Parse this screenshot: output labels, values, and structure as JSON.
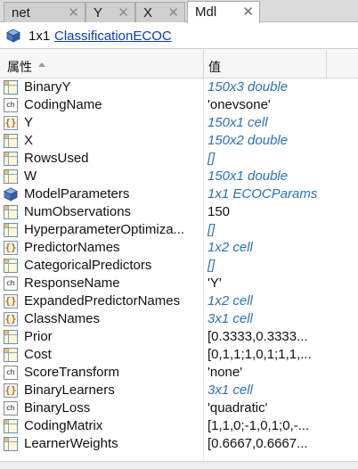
{
  "tabs": [
    {
      "label": "net",
      "active": false
    },
    {
      "label": "Y",
      "active": false
    },
    {
      "label": "X",
      "active": false
    },
    {
      "label": "Mdl",
      "active": true
    }
  ],
  "tab_close_glyph": "✕",
  "header": {
    "size": "1x1",
    "class_link": "ClassificationECOC",
    "icon": "object-cube-icon"
  },
  "columns": {
    "name": "属性",
    "value": "值",
    "sort": "ascending"
  },
  "rows": [
    {
      "name": "BinaryY",
      "value": "150x3 double",
      "icon": "grid",
      "italic": true
    },
    {
      "name": "CodingName",
      "value": "'onevsone'",
      "icon": "char",
      "italic": false
    },
    {
      "name": "Y",
      "value": "150x1 cell",
      "icon": "cell",
      "italic": true
    },
    {
      "name": "X",
      "value": "150x2 double",
      "icon": "grid",
      "italic": true
    },
    {
      "name": "RowsUsed",
      "value": "[]",
      "icon": "grid",
      "italic": true
    },
    {
      "name": "W",
      "value": "150x1 double",
      "icon": "grid",
      "italic": true
    },
    {
      "name": "ModelParameters",
      "value": "1x1 ECOCParams",
      "icon": "obj",
      "italic": true
    },
    {
      "name": "NumObservations",
      "value": "150",
      "icon": "grid",
      "italic": false
    },
    {
      "name": "HyperparameterOptimiza...",
      "value": "[]",
      "icon": "grid",
      "italic": true
    },
    {
      "name": "PredictorNames",
      "value": "1x2 cell",
      "icon": "cell",
      "italic": true
    },
    {
      "name": "CategoricalPredictors",
      "value": "[]",
      "icon": "grid",
      "italic": true
    },
    {
      "name": "ResponseName",
      "value": "'Y'",
      "icon": "char",
      "italic": false
    },
    {
      "name": "ExpandedPredictorNames",
      "value": "1x2 cell",
      "icon": "cell",
      "italic": true
    },
    {
      "name": "ClassNames",
      "value": "3x1 cell",
      "icon": "cell",
      "italic": true
    },
    {
      "name": "Prior",
      "value": "[0.3333,0.3333...",
      "icon": "grid",
      "italic": false
    },
    {
      "name": "Cost",
      "value": "[0,1,1;1,0,1;1,1,...",
      "icon": "grid",
      "italic": false
    },
    {
      "name": "ScoreTransform",
      "value": "'none'",
      "icon": "char",
      "italic": false
    },
    {
      "name": "BinaryLearners",
      "value": "3x1 cell",
      "icon": "cell",
      "italic": true
    },
    {
      "name": "BinaryLoss",
      "value": "'quadratic'",
      "icon": "char",
      "italic": false
    },
    {
      "name": "CodingMatrix",
      "value": "[1,1,0;-1,0,1;0,-...",
      "icon": "grid",
      "italic": false
    },
    {
      "name": "LearnerWeights",
      "value": "[0.6667,0.6667...",
      "icon": "grid",
      "italic": false
    }
  ],
  "icon_glyphs": {
    "cell": "{}",
    "char": "ch"
  },
  "colors": {
    "link": "#0b3bbd",
    "italic_value": "#2c72b6",
    "tabbar": "#dcdcdc"
  }
}
